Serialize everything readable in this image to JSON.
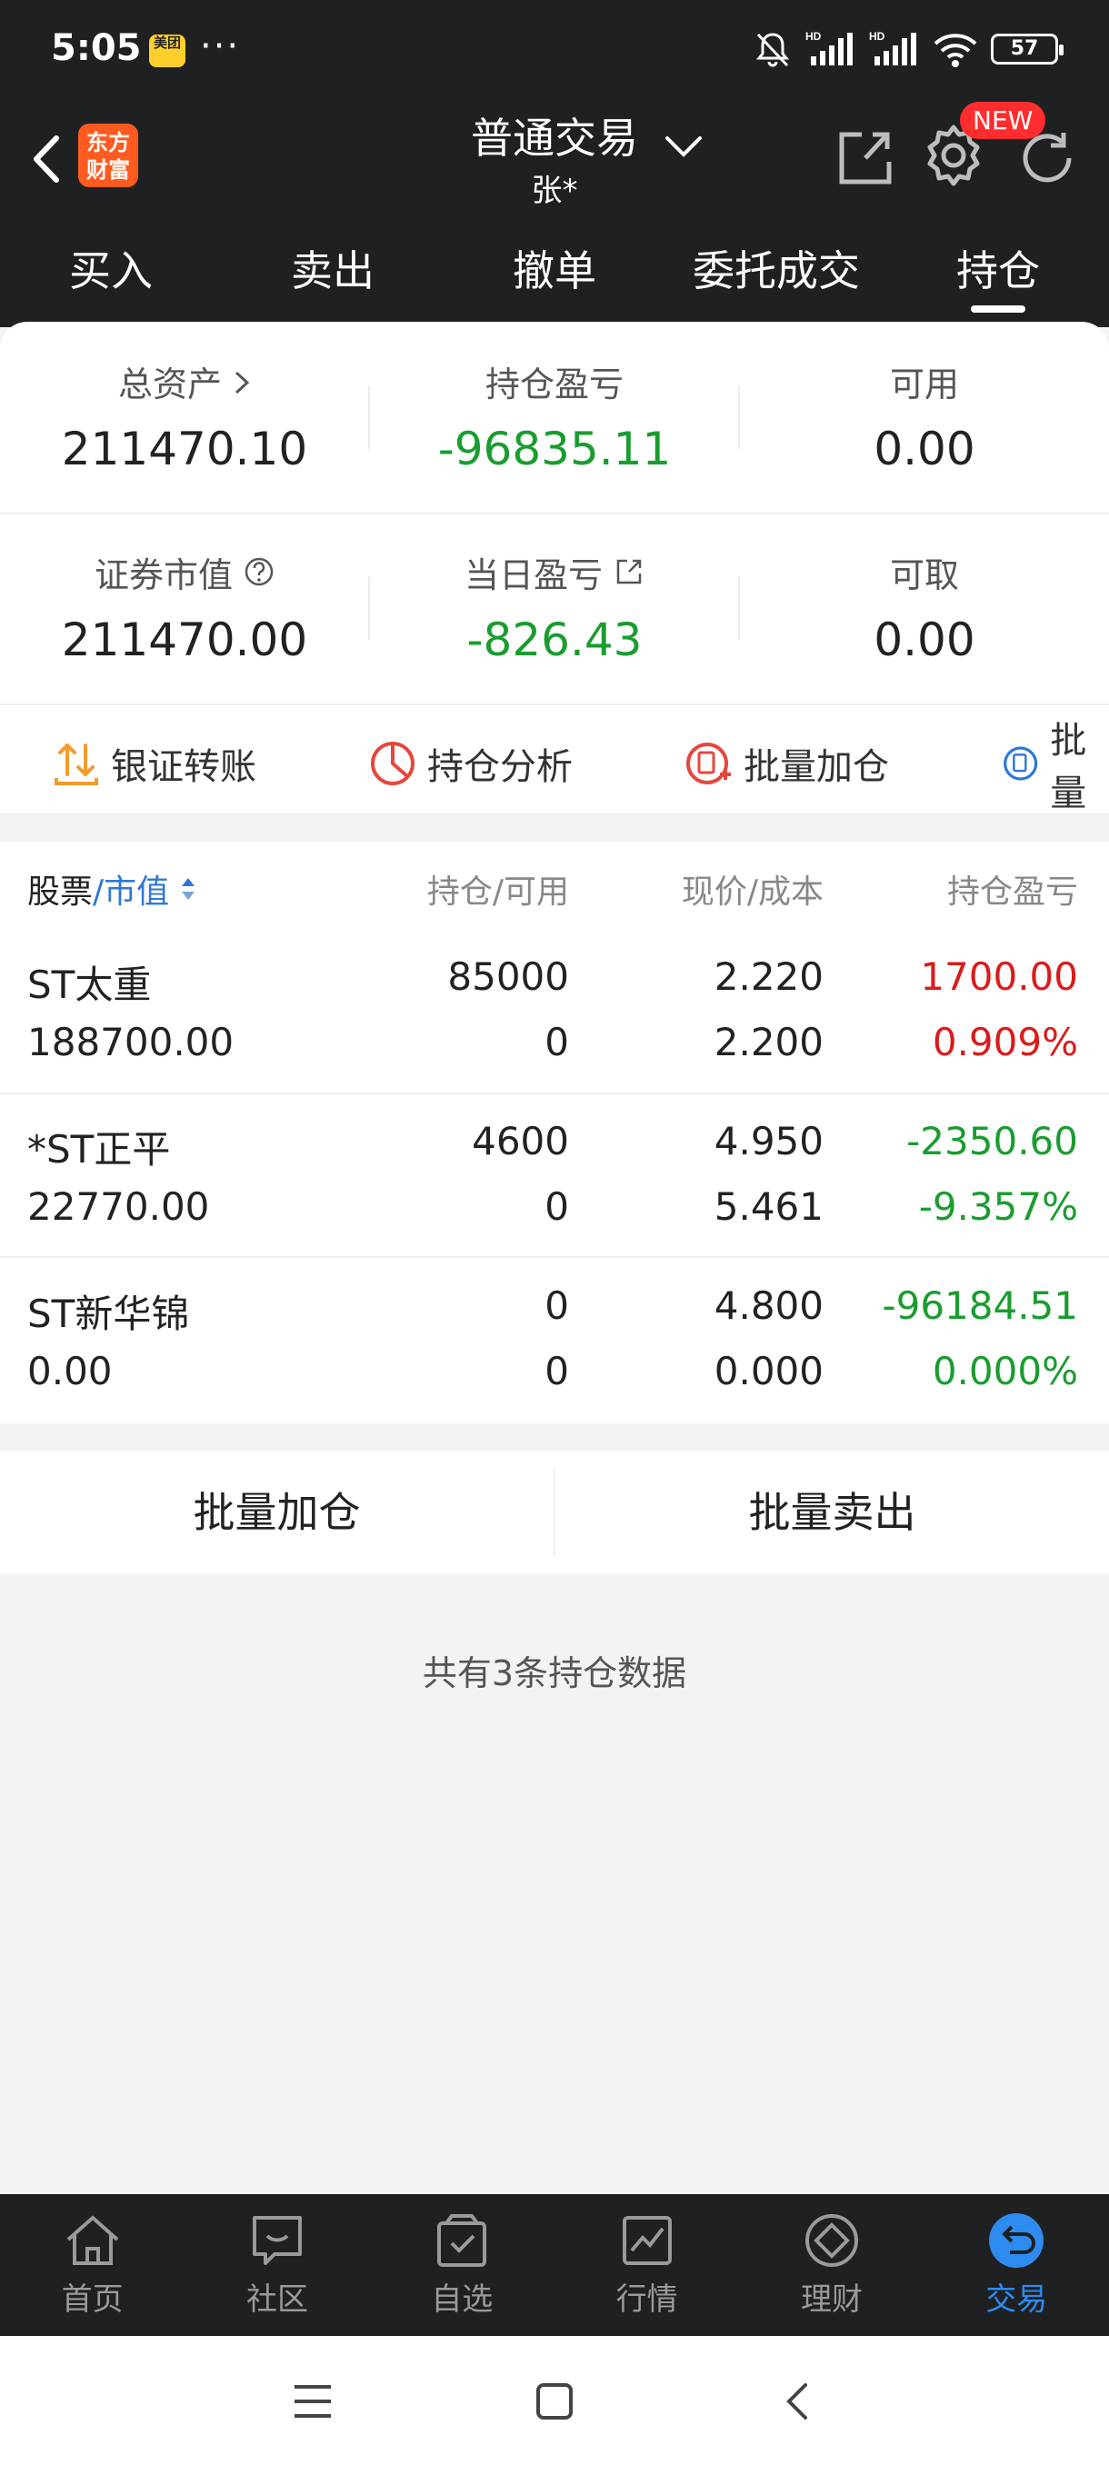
{
  "status_bar": {
    "time": "5:05",
    "app_badge": "美团",
    "more": "···",
    "battery": "57"
  },
  "header": {
    "logo_line1": "东方",
    "logo_line2": "财富",
    "title": "普通交易",
    "subtitle": "张*",
    "new_badge": "NEW"
  },
  "tabs": [
    {
      "label": "买入"
    },
    {
      "label": "卖出"
    },
    {
      "label": "撤单"
    },
    {
      "label": "委托成交"
    },
    {
      "label": "持仓",
      "active": true
    }
  ],
  "summary": {
    "total_assets_label": "总资产",
    "total_assets": "211470.10",
    "position_pl_label": "持仓盈亏",
    "position_pl": "-96835.11",
    "available_label": "可用",
    "available": "0.00",
    "market_value_label": "证券市值",
    "market_value": "211470.00",
    "daily_pl_label": "当日盈亏",
    "daily_pl": "-826.43",
    "withdrawable_label": "可取",
    "withdrawable": "0.00"
  },
  "quick_actions": [
    {
      "label": "银证转账",
      "icon": "transfer-icon"
    },
    {
      "label": "持仓分析",
      "icon": "pie-chart-icon"
    },
    {
      "label": "批量加仓",
      "icon": "batch-add-icon"
    },
    {
      "label": "批量",
      "icon": "batch-icon"
    }
  ],
  "table": {
    "headers": {
      "stock": "股票",
      "slash": "/",
      "market_value": "市值",
      "position_available": "持仓/可用",
      "price_cost": "现价/成本",
      "position_pl": "持仓盈亏"
    },
    "rows": [
      {
        "name": "ST太重",
        "market_value": "188700.00",
        "position": "85000",
        "available": "0",
        "price": "2.220",
        "cost": "2.200",
        "pl": "1700.00",
        "pl_pct": "0.909%",
        "pl_color": "#d81c1c"
      },
      {
        "name": "*ST正平",
        "market_value": "22770.00",
        "position": "4600",
        "available": "0",
        "price": "4.950",
        "cost": "5.461",
        "pl": "-2350.60",
        "pl_pct": "-9.357%",
        "pl_color": "#1a9c2f"
      },
      {
        "name": "ST新华锦",
        "market_value": "0.00",
        "position": "0",
        "available": "0",
        "price": "4.800",
        "cost": "0.000",
        "pl": "-96184.51",
        "pl_pct": "0.000%",
        "pl_color": "#1a9c2f"
      }
    ]
  },
  "actions": {
    "batch_add": "批量加仓",
    "batch_sell": "批量卖出"
  },
  "holdings_count": "共有3条持仓数据",
  "bottom_nav": [
    {
      "label": "首页",
      "icon": "home-icon"
    },
    {
      "label": "社区",
      "icon": "community-icon"
    },
    {
      "label": "自选",
      "icon": "watchlist-icon"
    },
    {
      "label": "行情",
      "icon": "market-icon"
    },
    {
      "label": "理财",
      "icon": "wealth-icon"
    },
    {
      "label": "交易",
      "icon": "trade-icon",
      "active": true
    }
  ],
  "colors": {
    "accent": "#2e8bf0",
    "gain": "#d81c1c",
    "loss": "#1a9c2f",
    "header_bg": "#1f2022"
  }
}
